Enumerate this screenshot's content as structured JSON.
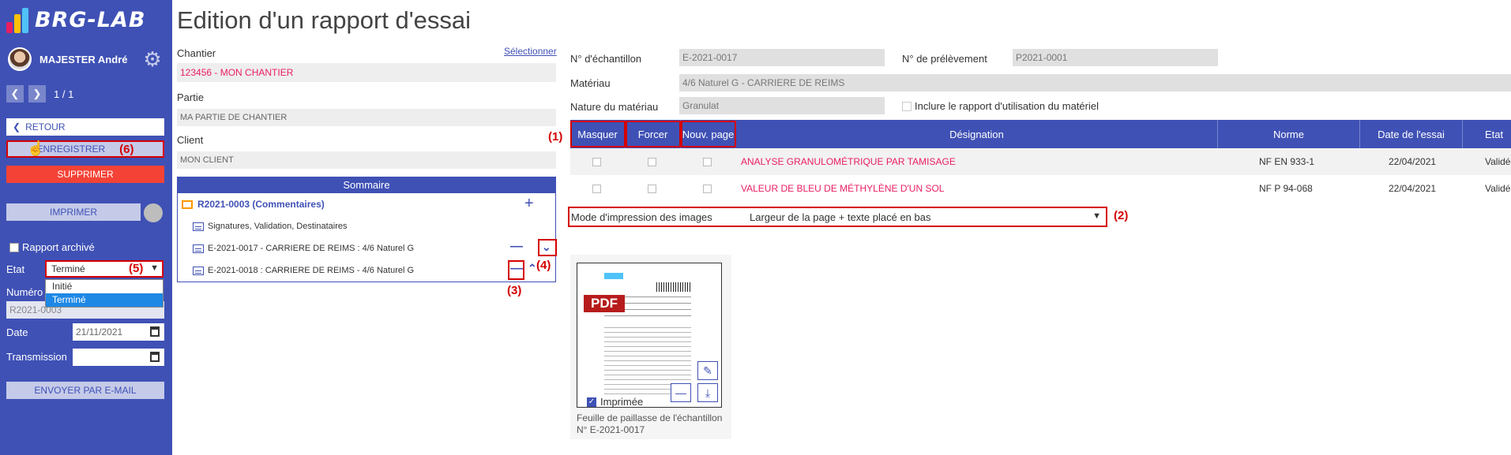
{
  "sidebar": {
    "logo_text": "BRG-LAB",
    "user_name": "MAJESTER André",
    "pager": "1 / 1",
    "retour": "RETOUR",
    "enregistrer": "ENREGISTRER",
    "supprimer": "SUPPRIMER",
    "imprimer": "IMPRIMER",
    "rapport_archive": "Rapport archivé",
    "etat_label": "Etat",
    "etat_value": "Terminé",
    "etat_options": [
      "Initié",
      "Terminé"
    ],
    "numero_label": "Numéro",
    "numero_value": "R2021-0003",
    "date_label": "Date",
    "date_value": "21/11/2021",
    "transmission_label": "Transmission",
    "envoyer": "ENVOYER PAR E-MAIL"
  },
  "page_title": "Edition d'un rapport d'essai",
  "chantier": {
    "label": "Chantier",
    "select_link": "Sélectionner",
    "value": "123456 - MON CHANTIER"
  },
  "partie": {
    "label": "Partie",
    "value": "MA PARTIE DE CHANTIER"
  },
  "client": {
    "label": "Client",
    "value": "MON CLIENT"
  },
  "sommaire": {
    "title": "Sommaire",
    "report": "R2021-0003 (Commentaires)",
    "rows": [
      "Signatures, Validation, Destinataires",
      "E-2021-0017 - CARRIERE DE REIMS : 4/6 Naturel G",
      "E-2021-0018 : CARRIERE DE REIMS - 4/6 Naturel G"
    ]
  },
  "annotations": [
    "(1)",
    "(2)",
    "(3)",
    "(4)",
    "(5)",
    "(6)"
  ],
  "sample": {
    "echantillon_label": "N° d'échantillon",
    "echantillon_value": "E-2021-0017",
    "prelevement_label": "N° de prélèvement",
    "prelevement_value": "P2021-0001",
    "materiau_label": "Matériau",
    "materiau_value": "4/6 Naturel G - CARRIERE DE REIMS",
    "nature_label": "Nature du matériau",
    "nature_value": "Granulat",
    "inclure_label": "Inclure le rapport d'utilisation du matériel"
  },
  "table": {
    "headers": [
      "Masquer",
      "Forcer",
      "Nouv. page",
      "Désignation",
      "Norme",
      "Date de l'essai",
      "Etat"
    ],
    "rows": [
      {
        "designation": "ANALYSE GRANULOMÉTRIQUE PAR TAMISAGE",
        "norme": "NF EN 933-1",
        "date": "22/04/2021",
        "etat": "Validé"
      },
      {
        "designation": "VALEUR DE BLEU DE MÉTHYLÈNE D'UN SOL",
        "norme": "NF P 94-068",
        "date": "22/04/2021",
        "etat": "Validé"
      }
    ]
  },
  "mode_impression": {
    "label": "Mode d'impression des images",
    "value": "Largeur de la page + texte placé en bas"
  },
  "card": {
    "pdf": "PDF",
    "imprimee": "Imprimée",
    "caption": "Feuille de paillasse de l'échantillon N° E-2021-0017"
  },
  "colors": {
    "primary": "#3f51b5",
    "danger": "#f44336",
    "highlight": "#d50000",
    "link_pink": "#e91e63"
  }
}
